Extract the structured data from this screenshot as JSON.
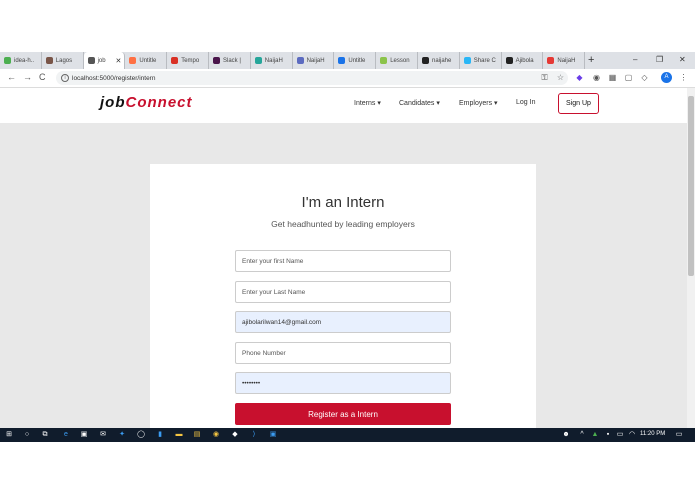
{
  "tabs": [
    {
      "label": "idea-h..",
      "color": "#4caf50"
    },
    {
      "label": "Lagos",
      "color": "#795548"
    },
    {
      "label": "job",
      "color": "#555555",
      "active": true
    },
    {
      "label": "Untitle",
      "color": "#ff7043"
    },
    {
      "label": "Tempo",
      "color": "#d93025"
    },
    {
      "label": "Slack |",
      "color": "#4a154b"
    },
    {
      "label": "NaijaH",
      "color": "#26a69a"
    },
    {
      "label": "NaijaH",
      "color": "#5c6bc0"
    },
    {
      "label": "Untitle",
      "color": "#1a73e8"
    },
    {
      "label": "Lesson",
      "color": "#8bc34a"
    },
    {
      "label": "naijahe",
      "color": "#222222"
    },
    {
      "label": "Share C",
      "color": "#29b6f6"
    },
    {
      "label": "Ajibola",
      "color": "#222222"
    },
    {
      "label": "NaijaH",
      "color": "#e53935"
    }
  ],
  "window": {
    "new_tab": "+",
    "minimize": "–",
    "maximize": "❐",
    "close": "✕"
  },
  "address": {
    "url": "localhost:5000/register/intern",
    "lock": "i",
    "back": "←",
    "forward": "→",
    "reload": "C",
    "avatar": "A"
  },
  "site": {
    "logo_job": "job",
    "logo_connect": "Connect",
    "nav": {
      "interns": "Interns ▾",
      "candidates": "Candidates ▾",
      "employers": "Employers ▾",
      "login": "Log In",
      "signup": "Sign Up"
    }
  },
  "form": {
    "title": "I'm an Intern",
    "subtitle": "Get headhunted by leading employers",
    "first_name_placeholder": "Enter your first Name",
    "last_name_placeholder": "Enter your Last Name",
    "email_value": "ajibolarilwan14@gmail.com",
    "phone_placeholder": "Phone Number",
    "password_value": "••••••••",
    "submit": "Register as a Intern"
  },
  "taskbar": {
    "time": "11:20 PM"
  },
  "colors": {
    "accent": "#c8102e",
    "taskbar": "#101c2c",
    "autofill": "#e8f0fe"
  }
}
